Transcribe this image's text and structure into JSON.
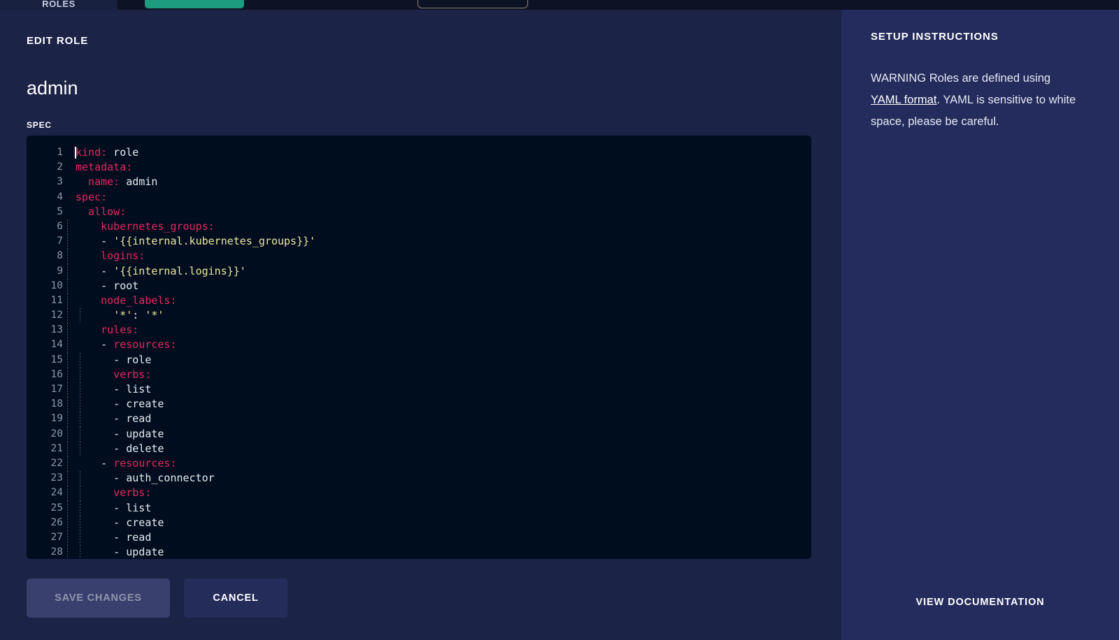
{
  "chrome": {
    "tab_label": "ROLES",
    "create_button_label": "",
    "search_placeholder": ""
  },
  "edit_pane": {
    "section_title": "EDIT ROLE",
    "role_name": "admin",
    "spec_label": "SPEC",
    "save_label": "SAVE CHANGES",
    "cancel_label": "CANCEL"
  },
  "editor": {
    "language": "yaml",
    "lines": [
      {
        "n": "1",
        "guides": [],
        "tokens": [
          {
            "t": "kind:",
            "c": "k"
          },
          {
            "t": " role",
            "c": "v"
          }
        ],
        "caret": true
      },
      {
        "n": "2",
        "guides": [],
        "tokens": [
          {
            "t": "metadata:",
            "c": "k"
          }
        ]
      },
      {
        "n": "3",
        "guides": [],
        "tokens": [
          {
            "t": "  name:",
            "c": "k"
          },
          {
            "t": " admin",
            "c": "v"
          }
        ]
      },
      {
        "n": "4",
        "guides": [],
        "tokens": [
          {
            "t": "spec:",
            "c": "k"
          }
        ]
      },
      {
        "n": "5",
        "guides": [],
        "tokens": [
          {
            "t": "  allow:",
            "c": "k"
          }
        ]
      },
      {
        "n": "6",
        "guides": [
          "g1"
        ],
        "tokens": [
          {
            "t": "    kubernetes_groups:",
            "c": "k"
          }
        ]
      },
      {
        "n": "7",
        "guides": [
          "g1"
        ],
        "tokens": [
          {
            "t": "    - ",
            "c": "v"
          },
          {
            "t": "'{{internal.kubernetes_groups}}'",
            "c": "s"
          }
        ]
      },
      {
        "n": "8",
        "guides": [
          "g1"
        ],
        "tokens": [
          {
            "t": "    logins:",
            "c": "k"
          }
        ]
      },
      {
        "n": "9",
        "guides": [
          "g1"
        ],
        "tokens": [
          {
            "t": "    - ",
            "c": "v"
          },
          {
            "t": "'{{internal.logins}}'",
            "c": "s"
          }
        ]
      },
      {
        "n": "10",
        "guides": [
          "g1"
        ],
        "tokens": [
          {
            "t": "    - root",
            "c": "v"
          }
        ]
      },
      {
        "n": "11",
        "guides": [
          "g1"
        ],
        "tokens": [
          {
            "t": "    node_labels:",
            "c": "k"
          }
        ]
      },
      {
        "n": "12",
        "guides": [
          "g1",
          "g2"
        ],
        "tokens": [
          {
            "t": "      ",
            "c": "v"
          },
          {
            "t": "'*'",
            "c": "s"
          },
          {
            "t": ": ",
            "c": "v"
          },
          {
            "t": "'*'",
            "c": "s"
          }
        ]
      },
      {
        "n": "13",
        "guides": [
          "g1"
        ],
        "tokens": [
          {
            "t": "    rules:",
            "c": "k"
          }
        ]
      },
      {
        "n": "14",
        "guides": [
          "g1"
        ],
        "tokens": [
          {
            "t": "    - ",
            "c": "v"
          },
          {
            "t": "resources:",
            "c": "k"
          }
        ]
      },
      {
        "n": "15",
        "guides": [
          "g1",
          "g2"
        ],
        "tokens": [
          {
            "t": "      - role",
            "c": "v"
          }
        ]
      },
      {
        "n": "16",
        "guides": [
          "g1",
          "g2"
        ],
        "tokens": [
          {
            "t": "      verbs:",
            "c": "k"
          }
        ]
      },
      {
        "n": "17",
        "guides": [
          "g1",
          "g2"
        ],
        "tokens": [
          {
            "t": "      - list",
            "c": "v"
          }
        ]
      },
      {
        "n": "18",
        "guides": [
          "g1",
          "g2"
        ],
        "tokens": [
          {
            "t": "      - create",
            "c": "v"
          }
        ]
      },
      {
        "n": "19",
        "guides": [
          "g1",
          "g2"
        ],
        "tokens": [
          {
            "t": "      - read",
            "c": "v"
          }
        ]
      },
      {
        "n": "20",
        "guides": [
          "g1",
          "g2"
        ],
        "tokens": [
          {
            "t": "      - update",
            "c": "v"
          }
        ]
      },
      {
        "n": "21",
        "guides": [
          "g1",
          "g2"
        ],
        "tokens": [
          {
            "t": "      - delete",
            "c": "v"
          }
        ]
      },
      {
        "n": "22",
        "guides": [
          "g1"
        ],
        "tokens": [
          {
            "t": "    - ",
            "c": "v"
          },
          {
            "t": "resources:",
            "c": "k"
          }
        ]
      },
      {
        "n": "23",
        "guides": [
          "g1",
          "g2"
        ],
        "tokens": [
          {
            "t": "      - auth_connector",
            "c": "v"
          }
        ]
      },
      {
        "n": "24",
        "guides": [
          "g1",
          "g2"
        ],
        "tokens": [
          {
            "t": "      verbs:",
            "c": "k"
          }
        ]
      },
      {
        "n": "25",
        "guides": [
          "g1",
          "g2"
        ],
        "tokens": [
          {
            "t": "      - list",
            "c": "v"
          }
        ]
      },
      {
        "n": "26",
        "guides": [
          "g1",
          "g2"
        ],
        "tokens": [
          {
            "t": "      - create",
            "c": "v"
          }
        ]
      },
      {
        "n": "27",
        "guides": [
          "g1",
          "g2"
        ],
        "tokens": [
          {
            "t": "      - read",
            "c": "v"
          }
        ]
      },
      {
        "n": "28",
        "guides": [
          "g1",
          "g2"
        ],
        "tokens": [
          {
            "t": "      - update",
            "c": "v"
          }
        ]
      }
    ]
  },
  "instructions": {
    "title": "SETUP INSTRUCTIONS",
    "body_before_link": "WARNING Roles are defined using ",
    "link_label": "YAML format",
    "body_after_link": ". YAML is sensitive to white space, please be careful.",
    "doc_link_label": "VIEW DOCUMENTATION"
  },
  "colors": {
    "page_background": "#1b2347",
    "sidebar_background": "#232c5c",
    "editor_background": "#000d1e",
    "yaml_key": "#e4295f",
    "yaml_string": "#f0e6a0",
    "yaml_value": "#e8eaf0",
    "accent_green": "#1c9b7e"
  }
}
